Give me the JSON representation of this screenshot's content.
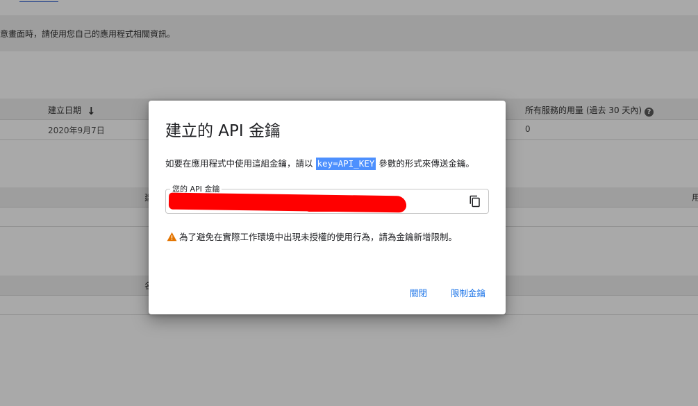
{
  "background": {
    "notice": "意畫面時，請使用您自己的應用程式相關資訊。",
    "table1": {
      "created_header": "建立日期",
      "usage_header": "所有服務的用量 (過去 30 天內)",
      "created_value": "2020年9月7日",
      "usage_value": "0"
    },
    "partial_label_1": "建",
    "partial_label_right": "用",
    "partial_label_2": "名"
  },
  "dialog": {
    "title": "建立的 API 金鑰",
    "desc_prefix": "如要在應用程式中使用這組金鑰，請以",
    "desc_code": "key=API_KEY",
    "desc_suffix": "參數的形式來傳送金鑰。",
    "field_label": "您的 API 金鑰",
    "field_value": "",
    "warning": "為了避免在實際工作環境中出現未授權的使用行為，請為金鑰新增限制。",
    "close_button": "關閉",
    "restrict_button": "限制金鑰"
  },
  "colors": {
    "accent": "#1a73e8",
    "code_highlight": "#4d90fe",
    "warning": "#e37400",
    "redaction": "#ff0000"
  },
  "icons": {
    "copy": "copy-icon",
    "warning": "warning-icon",
    "sort": "arrow-down-icon",
    "help": "help-icon"
  }
}
